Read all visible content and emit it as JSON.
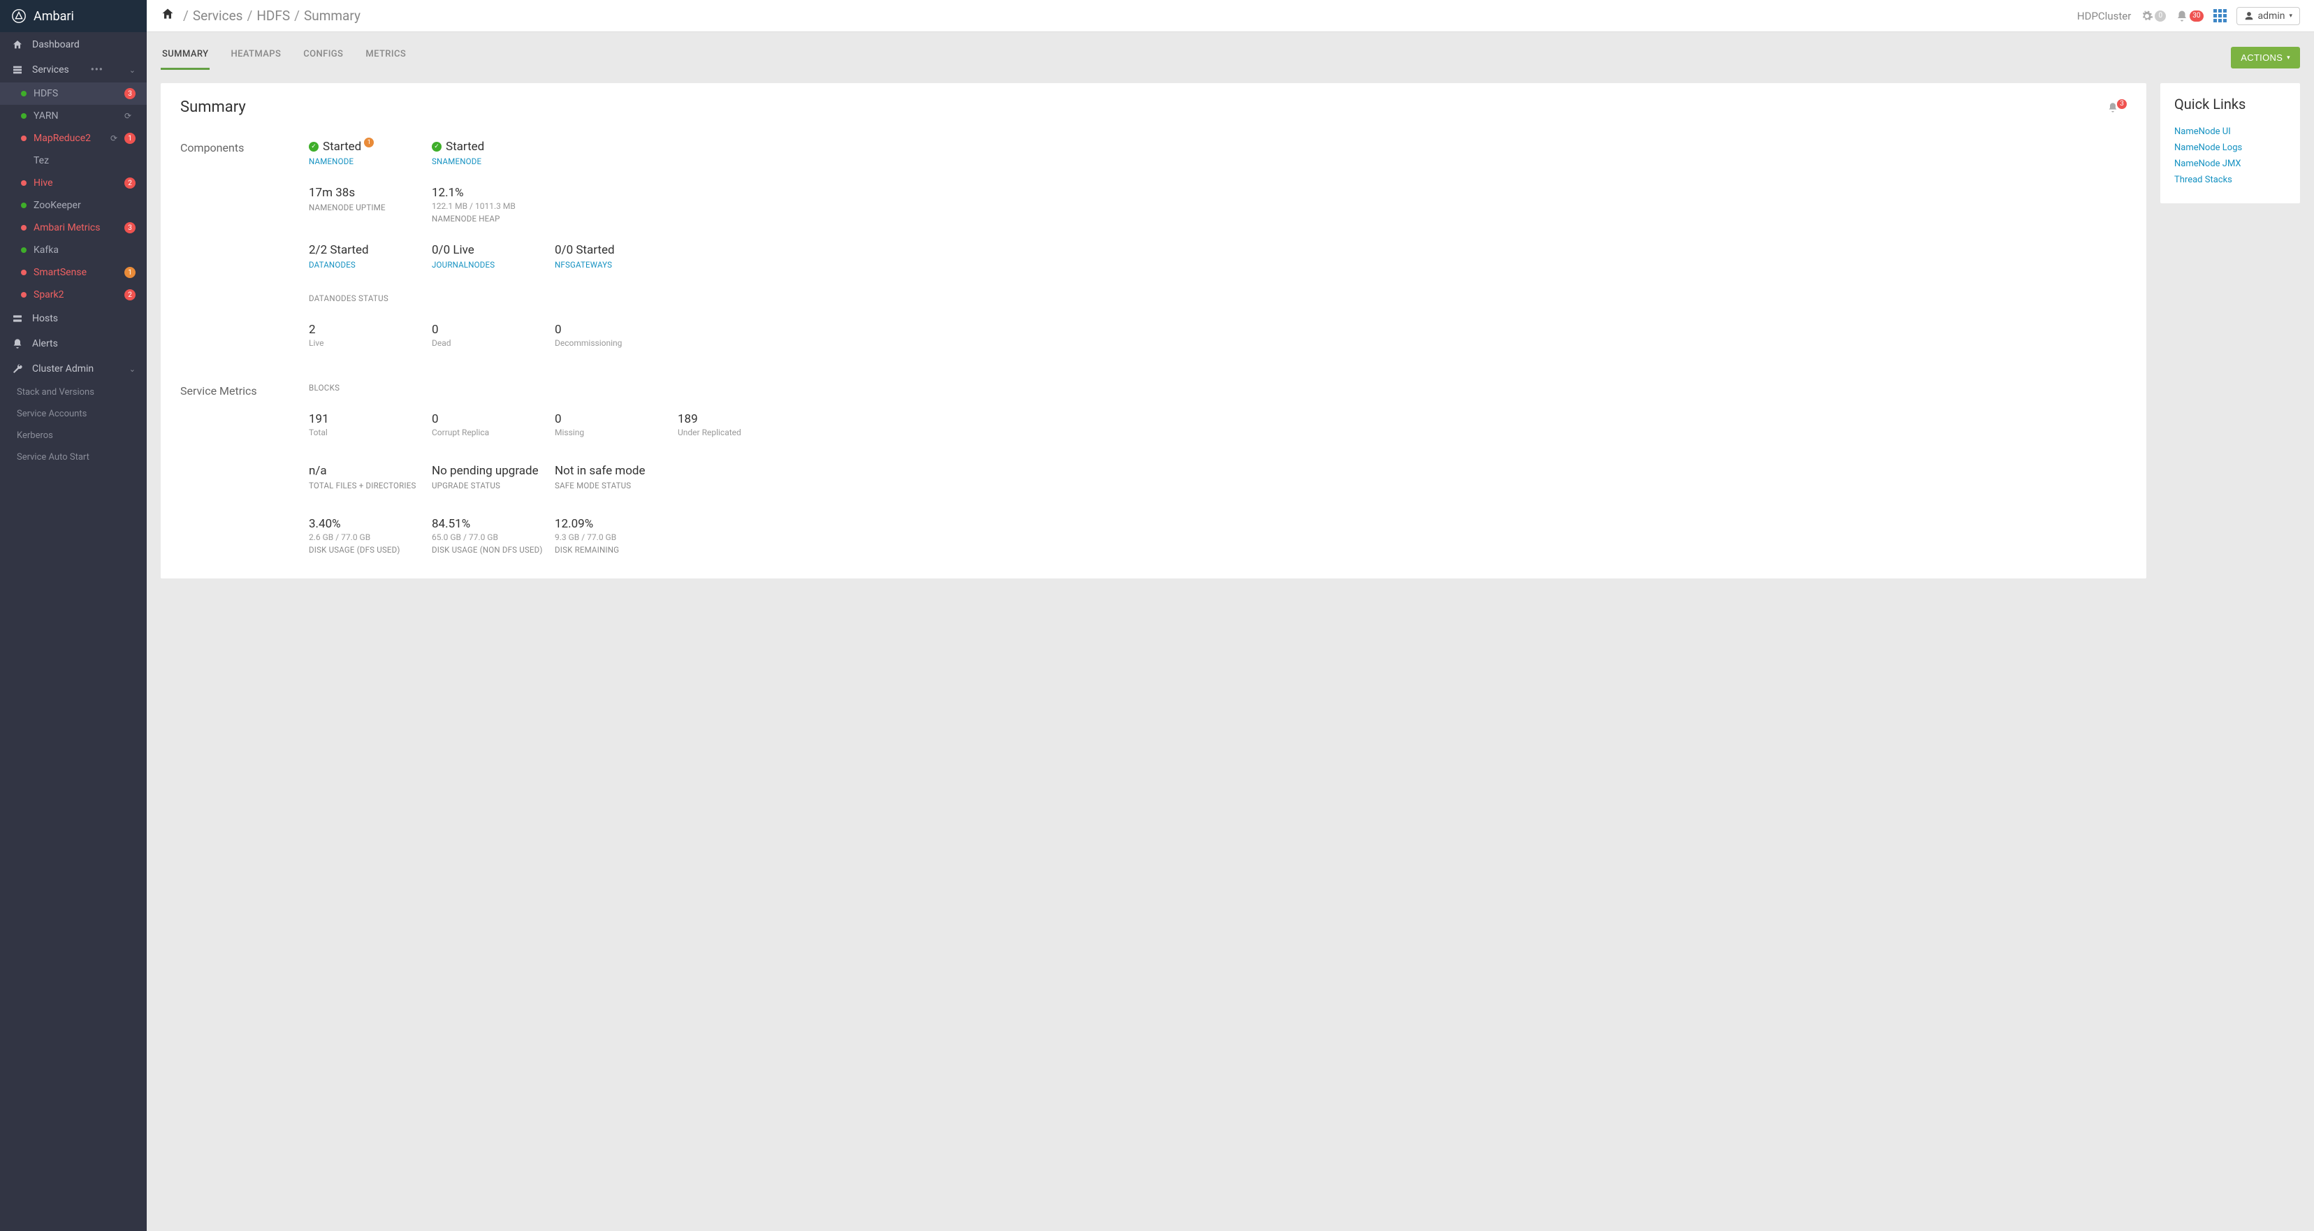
{
  "brand": "Ambari",
  "topbar": {
    "breadcrumb": [
      "Services",
      "HDFS",
      "Summary"
    ],
    "cluster_name": "HDPCluster",
    "ops_count": "0",
    "alerts_count": "30",
    "user_label": "admin"
  },
  "sidebar": {
    "nav": {
      "dashboard": "Dashboard",
      "services": "Services",
      "hosts": "Hosts",
      "alerts": "Alerts",
      "cluster_admin": "Cluster Admin"
    },
    "services": [
      {
        "name": "HDFS",
        "status": "green",
        "name_red": false,
        "badge": "3",
        "badge_color": "red",
        "refresh": false,
        "active": true
      },
      {
        "name": "YARN",
        "status": "green",
        "name_red": false,
        "badge": "",
        "refresh": true
      },
      {
        "name": "MapReduce2",
        "status": "red",
        "name_red": true,
        "badge": "1",
        "badge_color": "red",
        "refresh": true
      },
      {
        "name": "Tez",
        "status": "none",
        "name_red": false,
        "badge": ""
      },
      {
        "name": "Hive",
        "status": "red",
        "name_red": true,
        "badge": "2",
        "badge_color": "red"
      },
      {
        "name": "ZooKeeper",
        "status": "green",
        "name_red": false,
        "badge": ""
      },
      {
        "name": "Ambari Metrics",
        "status": "red",
        "name_red": true,
        "badge": "3",
        "badge_color": "red"
      },
      {
        "name": "Kafka",
        "status": "green",
        "name_red": false,
        "badge": ""
      },
      {
        "name": "SmartSense",
        "status": "red",
        "name_red": true,
        "badge": "1",
        "badge_color": "orange"
      },
      {
        "name": "Spark2",
        "status": "red",
        "name_red": true,
        "badge": "2",
        "badge_color": "red"
      }
    ],
    "cluster_admin_items": [
      "Stack and Versions",
      "Service Accounts",
      "Kerberos",
      "Service Auto Start"
    ]
  },
  "tabs": [
    "SUMMARY",
    "HEATMAPS",
    "CONFIGS",
    "METRICS"
  ],
  "actions_label": "ACTIONS",
  "summary": {
    "title": "Summary",
    "alert_count": "3",
    "components_label": "Components",
    "service_metrics_label": "Service Metrics",
    "namenode": {
      "status": "Started",
      "link": "NAMENODE",
      "warn": "1"
    },
    "snamenode": {
      "status": "Started",
      "link": "SNAMENODE"
    },
    "nn_uptime": {
      "value": "17m 38s",
      "label": "NAMENODE UPTIME"
    },
    "nn_heap": {
      "value": "12.1%",
      "sub": "122.1 MB / 1011.3 MB",
      "label": "NAMENODE HEAP"
    },
    "datanodes": {
      "value": "2/2 Started",
      "link": "DATANODES"
    },
    "journalnodes": {
      "value": "0/0 Live",
      "link": "JOURNALNODES"
    },
    "nfsgateways": {
      "value": "0/0 Started",
      "link": "NFSGATEWAYS"
    },
    "dn_status_label": "DATANODES STATUS",
    "dn_live": {
      "value": "2",
      "label": "Live"
    },
    "dn_dead": {
      "value": "0",
      "label": "Dead"
    },
    "dn_decom": {
      "value": "0",
      "label": "Decommissioning"
    },
    "blocks_label": "BLOCKS",
    "b_total": {
      "value": "191",
      "label": "Total"
    },
    "b_corrupt": {
      "value": "0",
      "label": "Corrupt Replica"
    },
    "b_missing": {
      "value": "0",
      "label": "Missing"
    },
    "b_under": {
      "value": "189",
      "label": "Under Replicated"
    },
    "files": {
      "value": "n/a",
      "label": "TOTAL FILES + DIRECTORIES"
    },
    "upgrade": {
      "value": "No pending upgrade",
      "label": "UPGRADE STATUS"
    },
    "safemode": {
      "value": "Not in safe mode",
      "label": "SAFE MODE STATUS"
    },
    "disk_dfs": {
      "value": "3.40%",
      "sub": "2.6 GB / 77.0 GB",
      "label": "DISK USAGE (DFS USED)"
    },
    "disk_nondfs": {
      "value": "84.51%",
      "sub": "65.0 GB / 77.0 GB",
      "label": "DISK USAGE (NON DFS USED)"
    },
    "disk_remain": {
      "value": "12.09%",
      "sub": "9.3 GB / 77.0 GB",
      "label": "DISK REMAINING"
    }
  },
  "quick_links": {
    "title": "Quick Links",
    "items": [
      "NameNode UI",
      "NameNode Logs",
      "NameNode JMX",
      "Thread Stacks"
    ]
  }
}
